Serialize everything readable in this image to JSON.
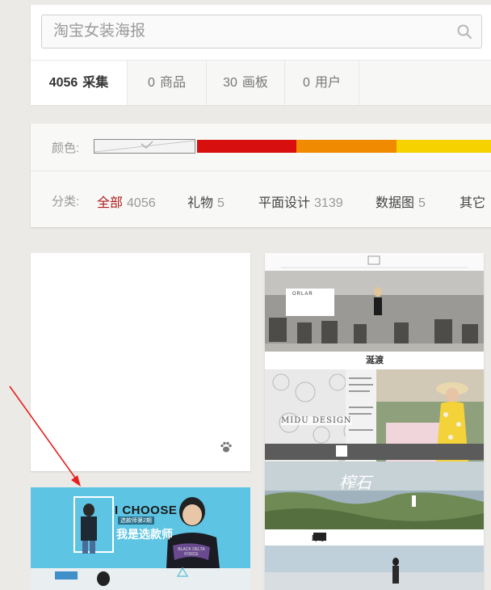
{
  "search": {
    "placeholder": "淘宝女装海报"
  },
  "tabs": [
    {
      "count": "4056",
      "label": "采集",
      "active": true
    },
    {
      "count": "0",
      "label": "商品"
    },
    {
      "count": "30",
      "label": "画板"
    },
    {
      "count": "0",
      "label": "用户"
    }
  ],
  "filter": {
    "color_label": "颜色:",
    "colors": [
      "#d80f0f",
      "#f08a00",
      "#f6d200"
    ],
    "category_label": "分类:",
    "categories": [
      {
        "label": "全部",
        "count": "4056",
        "active": true
      },
      {
        "label": "礼物",
        "count": "5"
      },
      {
        "label": "平面设计",
        "count": "3139"
      },
      {
        "label": "数据图",
        "count": "5"
      },
      {
        "label": "其它",
        "count": ""
      }
    ]
  },
  "pins": {
    "ichoose": {
      "headline": "I CHOOSE",
      "sub": "我是选款师",
      "tag": "选款师第2期",
      "shirt": "BLACK DELTA FORCE"
    },
    "long": {
      "banner1_sign": "ORLAR",
      "section_title": "涎渡",
      "midu": "MIDU DESIGN",
      "brand": "印象",
      "calligraphy": "榨石"
    }
  }
}
